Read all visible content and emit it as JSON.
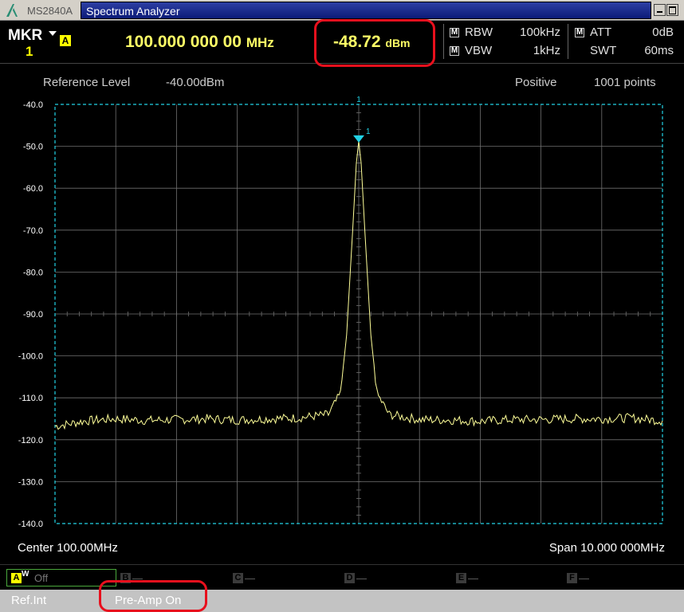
{
  "window": {
    "model": "MS2840A",
    "title": "Spectrum Analyzer"
  },
  "marker": {
    "label": "MKR",
    "number": "1",
    "trace": "A",
    "frequency": "100.000 000 00",
    "frequency_unit": "MHz",
    "level": "-48.72",
    "level_unit": "dBm"
  },
  "settings": {
    "rbw_label": "RBW",
    "rbw_value": "100kHz",
    "vbw_label": "VBW",
    "vbw_value": "1kHz",
    "att_label": "ATT",
    "att_value": "0dB",
    "swt_label": "SWT",
    "swt_value": "60ms",
    "manual_badge": "M"
  },
  "graph": {
    "reference_level_label": "Reference Level",
    "reference_level_value": "-40.00dBm",
    "detector": "Positive",
    "points": "1001 points",
    "center": "Center 100.00MHz",
    "span": "Span 10.000 000MHz",
    "y_ticks": [
      "-40.0",
      "-50.0",
      "-60.0",
      "-70.0",
      "-80.0",
      "-90.0",
      "-100.0",
      "-110.0",
      "-120.0",
      "-130.0",
      "-140.0"
    ],
    "marker_flag": "1",
    "marker_top_label": "1"
  },
  "chart_data": {
    "type": "line",
    "ylim": [
      -140,
      -40
    ],
    "xlim": [
      95,
      105
    ],
    "x_unit": "MHz",
    "y_unit": "dBm",
    "grid": true,
    "series": [
      {
        "color": "#ffff99",
        "points": [
          [
            95.0,
            -116.8
          ],
          [
            95.5,
            -115.5
          ],
          [
            96.0,
            -115.0
          ],
          [
            96.5,
            -115.4
          ],
          [
            97.0,
            -115.2
          ],
          [
            97.5,
            -115.0
          ],
          [
            98.0,
            -115.3
          ],
          [
            98.5,
            -115.0
          ],
          [
            99.0,
            -114.8
          ],
          [
            99.5,
            -114.0
          ],
          [
            99.7,
            -109.0
          ],
          [
            99.8,
            -95.0
          ],
          [
            99.9,
            -70.0
          ],
          [
            99.96,
            -54.0
          ],
          [
            100.0,
            -48.72
          ],
          [
            100.04,
            -54.0
          ],
          [
            100.1,
            -70.0
          ],
          [
            100.2,
            -95.0
          ],
          [
            100.3,
            -109.0
          ],
          [
            100.5,
            -114.0
          ],
          [
            101.0,
            -115.2
          ],
          [
            101.5,
            -115.3
          ],
          [
            102.0,
            -115.6
          ],
          [
            102.5,
            -115.2
          ],
          [
            103.0,
            -115.2
          ],
          [
            103.5,
            -115.0
          ],
          [
            104.0,
            -115.0
          ],
          [
            104.5,
            -114.8
          ],
          [
            105.0,
            -115.5
          ]
        ]
      }
    ],
    "marker": {
      "x": 100.0,
      "y": -48.72
    }
  },
  "traces": [
    {
      "letter": "A",
      "sub": "W",
      "state": "Off"
    },
    {
      "letter": "B",
      "state": "—"
    },
    {
      "letter": "C",
      "state": "—"
    },
    {
      "letter": "D",
      "state": "—"
    },
    {
      "letter": "E",
      "state": "—"
    },
    {
      "letter": "F",
      "state": "—"
    }
  ],
  "status": {
    "reference": "Ref.Int",
    "preamp": "Pre-Amp On"
  },
  "colors": {
    "trace": "#ffff99",
    "grid": "#707070",
    "graticule_border": "#22d3e6",
    "marker": "#22d3e6",
    "highlight": "#e8101d"
  }
}
